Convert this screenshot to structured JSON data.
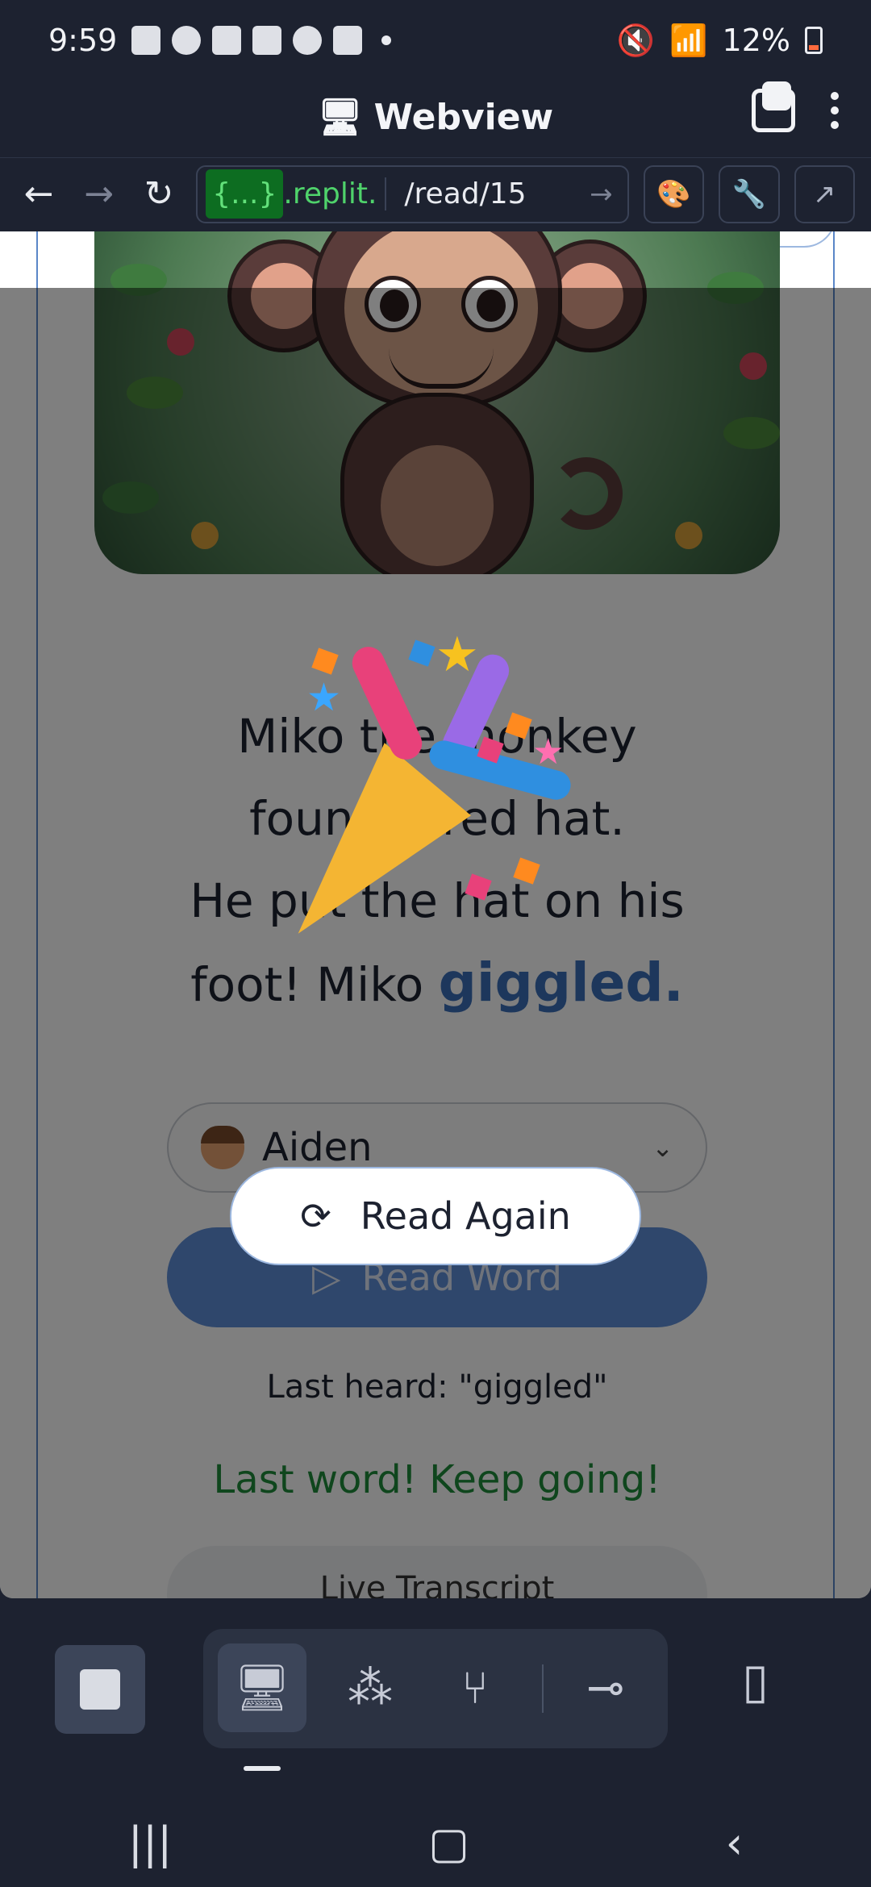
{
  "status_bar": {
    "time": "9:59",
    "battery": "12%"
  },
  "title_bar": {
    "title": "Webview"
  },
  "url_bar": {
    "host_badge": "{...}",
    "host_suffix": ".replit.",
    "path": "/read/15"
  },
  "story": {
    "line1": "Miko the monkey",
    "line2": "found a red hat.",
    "line3": "He put the hat on his",
    "line4_prefix": "foot! Miko ",
    "highlight_word": "giggled."
  },
  "reader_select": {
    "selected": "Aiden"
  },
  "buttons": {
    "read_word": "Read Word",
    "read_again": "Read Again"
  },
  "last_heard": "Last heard: \"giggled\"",
  "encouragement": "Last word! Keep going!",
  "transcript_pill": "Live Transcript",
  "colors": {
    "accent_blue": "#3a6fb8",
    "success_green": "#1f8c3b",
    "chrome_bg": "#1d2230"
  }
}
